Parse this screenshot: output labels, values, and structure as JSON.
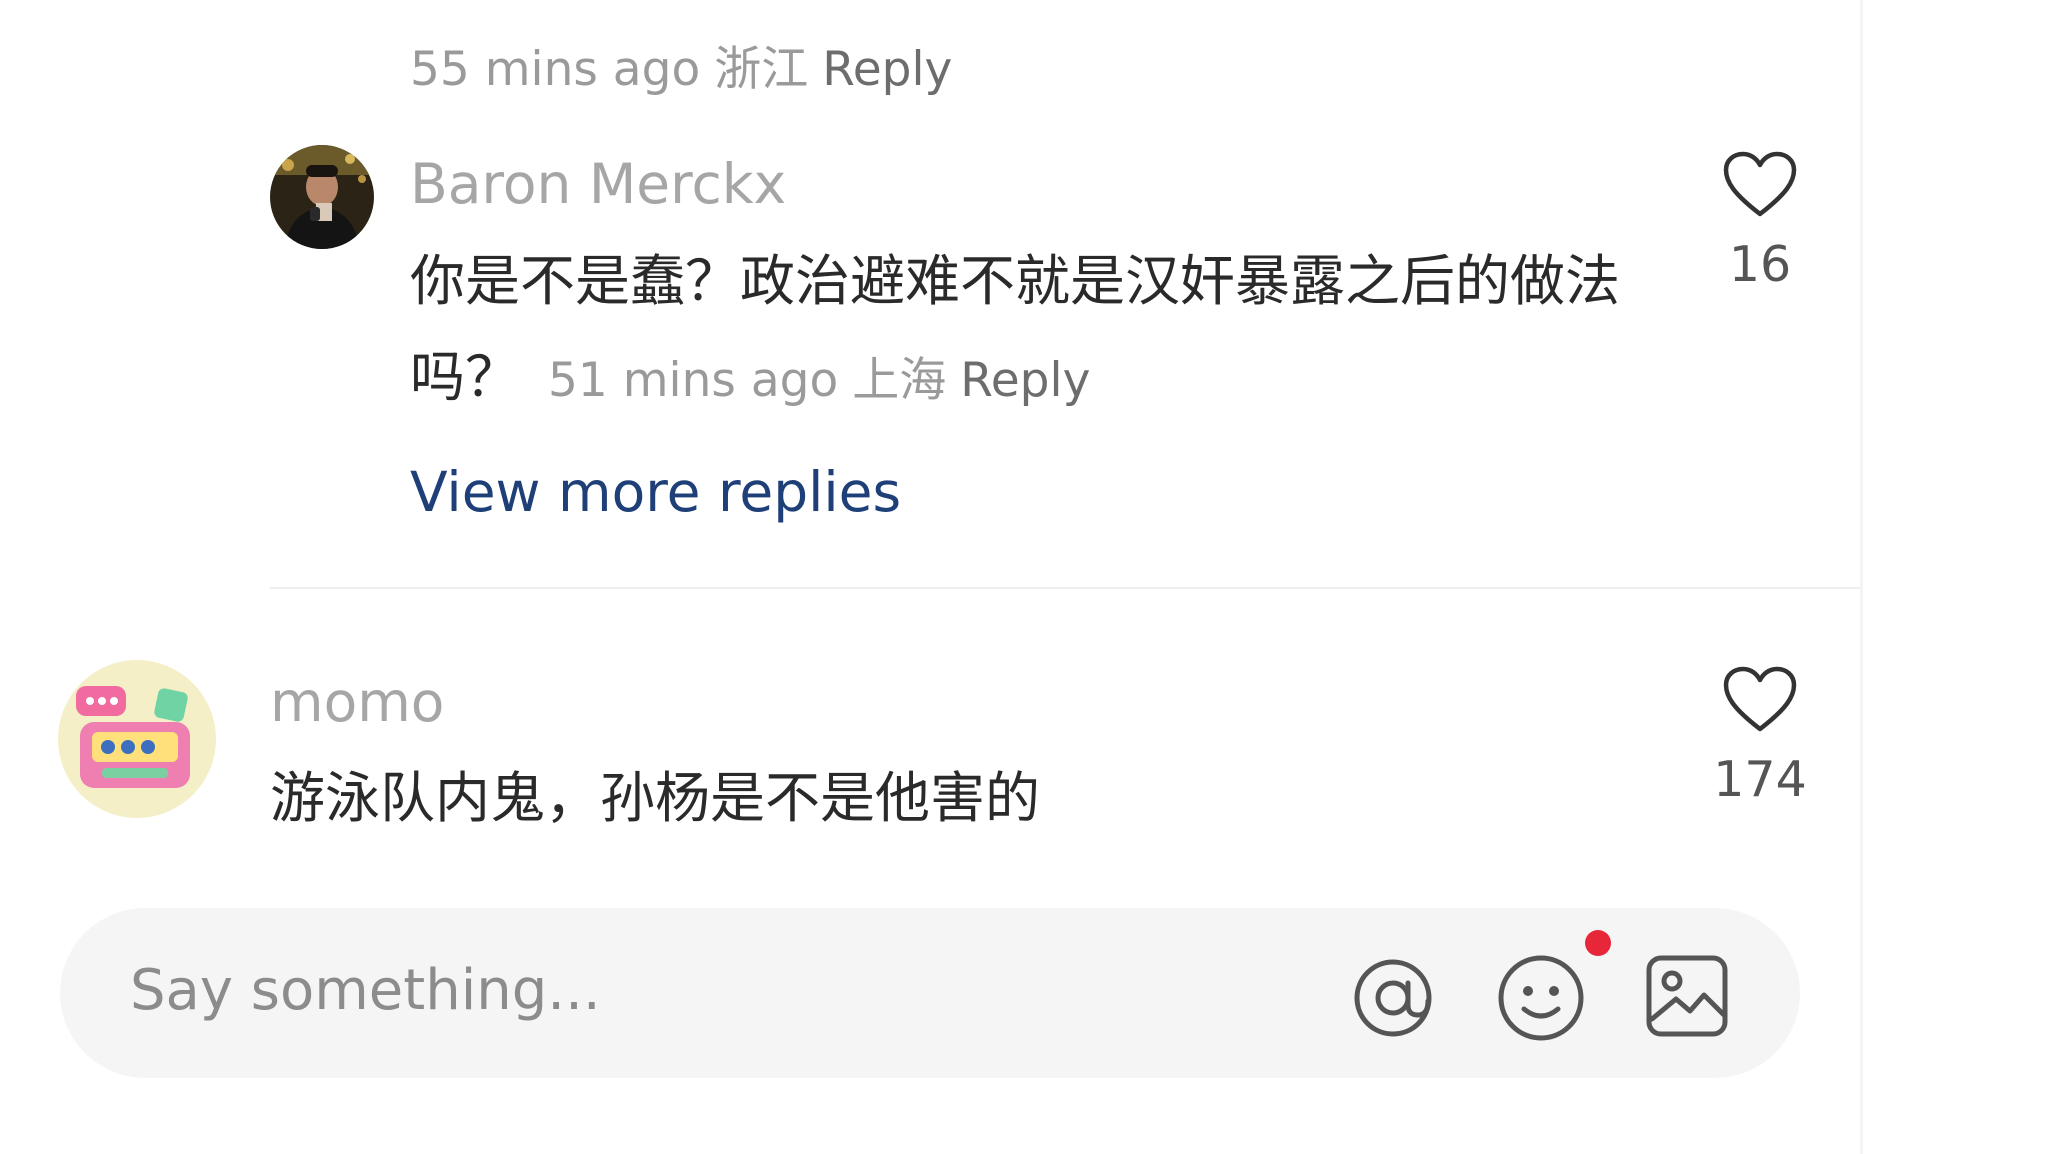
{
  "previous_reply": {
    "time": "55 mins ago",
    "location": "浙江",
    "reply_label": "Reply"
  },
  "reply": {
    "username": "Baron Merckx",
    "text": "你是不是蠢？政治避难不就是汉奸暴露之后的做法吗？",
    "time": "51 mins ago",
    "location": "上海",
    "reply_label": "Reply",
    "likes": "16"
  },
  "view_more_replies": "View more replies",
  "comment": {
    "username": "momo",
    "text": "游泳队内鬼，孙杨是不是他害的",
    "likes": "174"
  },
  "input_bar": {
    "placeholder": "Say something...",
    "icons": [
      "at-icon",
      "emoji-icon",
      "image-icon"
    ],
    "notification_dot_color": "#e8263a"
  },
  "colors": {
    "link": "#1f3f78",
    "muted_text": "#9a9a9a",
    "body_text": "#2a2a2a"
  }
}
